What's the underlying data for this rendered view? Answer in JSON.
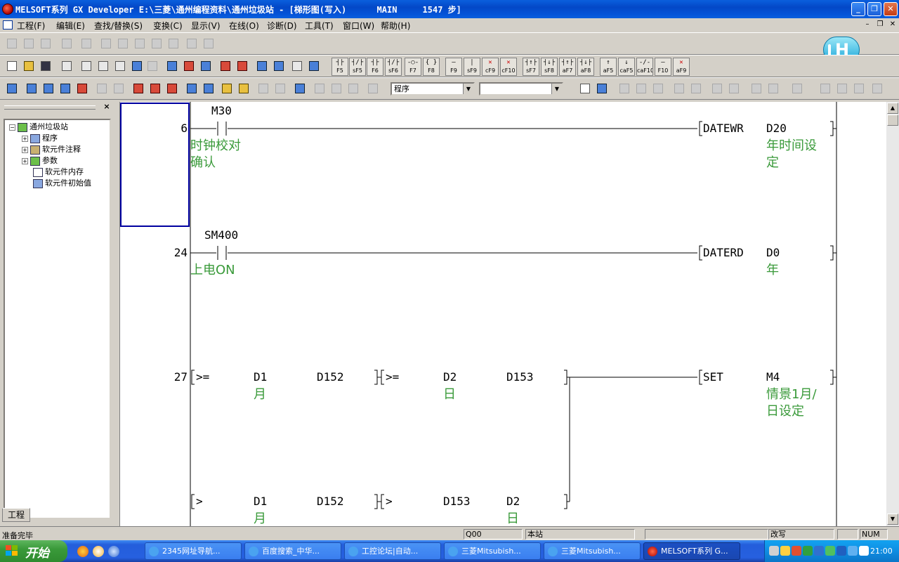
{
  "window": {
    "title": "MELSOFT系列 GX Developer E:\\三菱\\通州编程资料\\通州垃圾站 - [梯形图(写入)      MAIN     1547 步]",
    "min": "_",
    "max": "❐",
    "close": "✕"
  },
  "menu": {
    "items": [
      "工程(F)",
      "编辑(E)",
      "查找/替换(S)",
      "变换(C)",
      "显示(V)",
      "在线(O)",
      "诊断(D)",
      "工具(T)",
      "窗口(W)",
      "帮助(H)"
    ],
    "mdi_min": "–",
    "mdi_restore": "❐",
    "mdi_close": "✕"
  },
  "fkeys": [
    {
      "sym": "┤├",
      "label": "F5"
    },
    {
      "sym": "┤/├",
      "label": "sF5"
    },
    {
      "sym": "┤├",
      "label": "F6"
    },
    {
      "sym": "┤/├",
      "label": "sF6"
    },
    {
      "sym": "-○-",
      "label": "F7"
    },
    {
      "sym": "{ }",
      "label": "F8"
    },
    {
      "sym": "—",
      "label": "F9"
    },
    {
      "sym": "│",
      "label": "sF9"
    },
    {
      "sym": "✕",
      "label": "cF9"
    },
    {
      "sym": "✕",
      "label": "cF10"
    },
    {
      "sym": "┤↑├",
      "label": "sF7"
    },
    {
      "sym": "┤↓├",
      "label": "sF8"
    },
    {
      "sym": "┤↑├",
      "label": "aF7"
    },
    {
      "sym": "┤↓├",
      "label": "aF8"
    },
    {
      "sym": "↑",
      "label": "aF5"
    },
    {
      "sym": "↓",
      "label": "caF5"
    },
    {
      "sym": "-/-",
      "label": "caF10"
    },
    {
      "sym": "—",
      "label": "F10"
    },
    {
      "sym": "✕",
      "label": "aF9"
    }
  ],
  "toolbar3": {
    "combo1_value": "程序",
    "combo2_value": "",
    "dropdown_arrow": "▼"
  },
  "htray": {
    "letter": "H"
  },
  "project_panel": {
    "close": "×",
    "root": "通州垃圾站",
    "items": [
      "程序",
      "软元件注释",
      "参数",
      "软元件内存",
      "软元件初始值"
    ],
    "expander_plus": "+",
    "expander_minus": "−",
    "tab": "工程"
  },
  "ladder": {
    "rungs": [
      {
        "step": "6",
        "contact": "M30",
        "contact_comment": [
          "时钟校对",
          "确认"
        ],
        "instr": "DATEWR",
        "operand": "D20",
        "operand_comment": [
          "年时间设",
          "定"
        ]
      },
      {
        "step": "24",
        "contact": "SM400",
        "contact_comment": [
          "上电ON"
        ],
        "instr": "DATERD",
        "operand": "D0",
        "operand_comment": [
          "年"
        ]
      },
      {
        "step": "27",
        "cmp1": ">=",
        "cmp1_a": "D1",
        "cmp1_a_comment": "月",
        "cmp1_b": "D152",
        "cmp2": ">=",
        "cmp2_a": "D2",
        "cmp2_a_comment": "日",
        "cmp2_b": "D153",
        "instr": "SET",
        "operand": "M4",
        "operand_comment": [
          "情景1月/",
          "日设定"
        ]
      },
      {
        "cmp1": ">",
        "cmp1_a": "D1",
        "cmp1_a_comment": "月",
        "cmp1_b": "D152",
        "cmp2": ">",
        "cmp2_a": "D153",
        "cmp2_b": "D2",
        "cmp2_b_comment": "日"
      }
    ]
  },
  "scrollbar": {
    "up": "▲",
    "down": "▼"
  },
  "status": {
    "left": "准备完毕",
    "plc": "Q00",
    "station": "本站",
    "mode": "改写",
    "num": "NUM"
  },
  "taskbar": {
    "start": "开始",
    "tasks": [
      "2345网址导航...",
      "百度搜索_中华...",
      "工控论坛|自动...",
      "三菱Mitsubish...",
      "三菱Mitsubish...",
      "MELSOFT系列 G..."
    ],
    "clock": "21:00"
  }
}
